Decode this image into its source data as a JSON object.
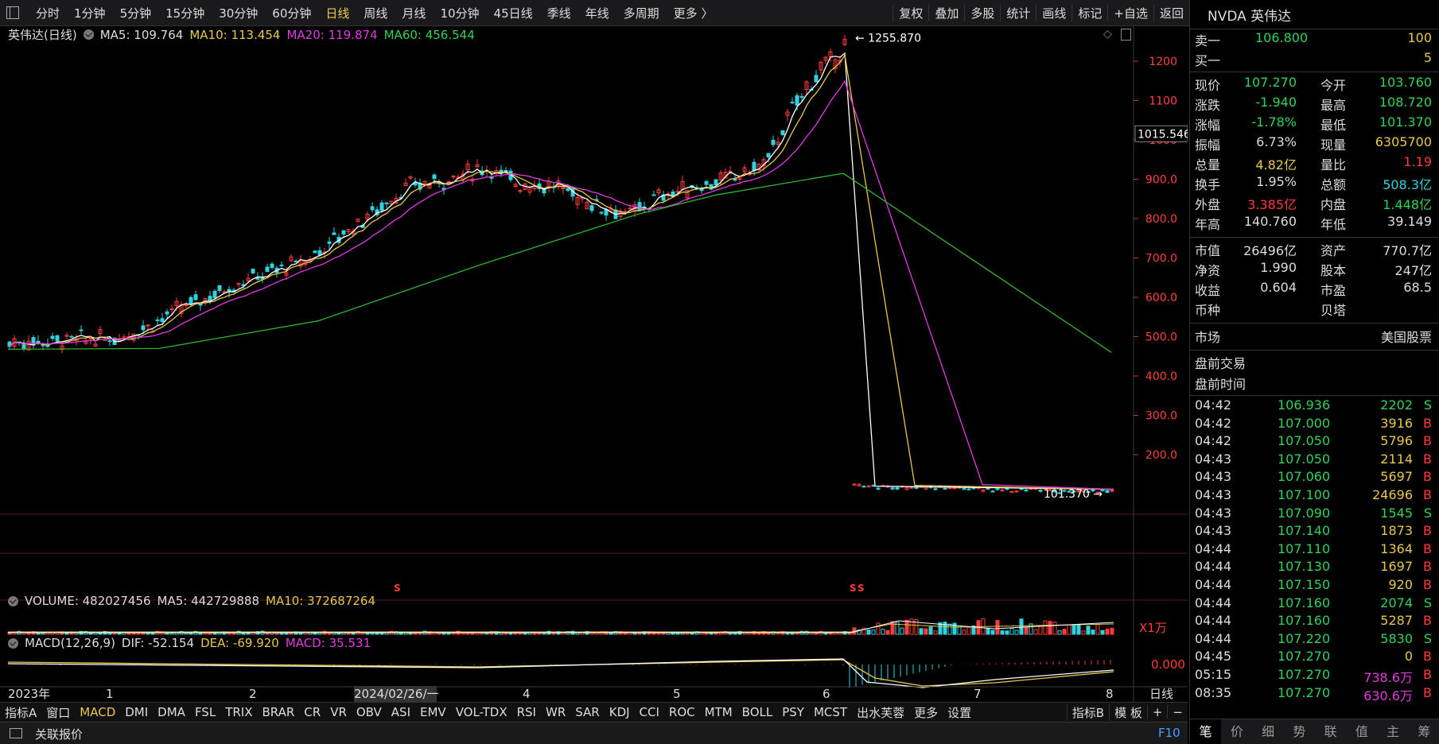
{
  "toolbar": {
    "periods": [
      "分时",
      "1分钟",
      "5分钟",
      "15分钟",
      "30分钟",
      "60分钟",
      "日线",
      "周线",
      "月线",
      "10分钟",
      "45日线",
      "季线",
      "年线",
      "多周期",
      "更多 〉"
    ],
    "active_period": "日线",
    "right_items": [
      "复权",
      "叠加",
      "多股",
      "统计",
      "画线",
      "标记",
      "+自选",
      "返回"
    ]
  },
  "chart": {
    "legend": {
      "title": "英伟达(日线)",
      "ma5": "MA5: 109.764",
      "ma10": "MA10: 113.454",
      "ma20": "MA20: 119.874",
      "ma60": "MA60: 456.544"
    },
    "y_ticks": [
      "1200",
      "1100",
      "1000",
      "900.0",
      "800.0",
      "700.0",
      "600.0",
      "500.0",
      "400.0",
      "300.0",
      "200.0"
    ],
    "current_marker": "1015.546",
    "high_label": "1255.870",
    "low_label": "101.370",
    "volume_legend": {
      "volume": "VOLUME: 482027456",
      "ma5": "MA5: 442729888",
      "ma10": "MA10: 372687264",
      "unit": "X1万"
    },
    "macd_legend": {
      "name": "MACD(12,26,9)",
      "dif": "DIF: -52.154",
      "dea": "DEA: -69.920",
      "macd": "MACD: 35.531",
      "zero": "0.000"
    },
    "x_labels": [
      "2023年",
      "1",
      "2",
      "2024/02/26/一",
      "4",
      "5",
      "6",
      "7",
      "8"
    ],
    "period_label": "日线",
    "signal_mark": "S"
  },
  "chart_data": {
    "type": "candlestick",
    "title": "英伟达(日线)",
    "ylim": [
      100,
      1260
    ],
    "high": 1255.87,
    "low": 101.37,
    "ma_labels": [
      "MA5",
      "MA10",
      "MA20",
      "MA60"
    ],
    "ma_values": [
      109.764,
      113.454,
      119.874,
      456.544
    ],
    "ma_colors": [
      "#ffffff",
      "#e8c84a",
      "#e23be2",
      "#2fb52f"
    ]
  },
  "indicator_tabs": [
    "指标A",
    "窗口",
    "MACD",
    "DMI",
    "DMA",
    "FSL",
    "TRIX",
    "BRAR",
    "CR",
    "VR",
    "OBV",
    "ASI",
    "EMV",
    "VOL-TDX",
    "RSI",
    "WR",
    "SAR",
    "KDJ",
    "CCI",
    "ROC",
    "MTM",
    "BOLL",
    "PSY",
    "MCST",
    "出水芙蓉",
    "更多",
    "设置"
  ],
  "indicator_active": "MACD",
  "indicator_right": [
    "指标B",
    "模 板",
    "+",
    "−"
  ],
  "status": {
    "left": "关联报价",
    "right": "F10"
  },
  "panel": {
    "title": "NVDA 英伟达",
    "ask": {
      "label": "卖一",
      "price": "106.800",
      "vol": "100"
    },
    "bid": {
      "label": "买一",
      "price": "",
      "vol": "5"
    },
    "stats": [
      [
        "现价",
        "107.270",
        "今开",
        "103.760"
      ],
      [
        "涨跌",
        "-1.940",
        "最高",
        "108.720"
      ],
      [
        "涨幅",
        "-1.78%",
        "最低",
        "101.370"
      ],
      [
        "振幅",
        "6.73%",
        "现量",
        "6305700"
      ],
      [
        "总量",
        "4.82亿",
        "量比",
        "1.19"
      ],
      [
        "换手",
        "1.95%",
        "总额",
        "508.3亿"
      ],
      [
        "外盘",
        "3.385亿",
        "内盘",
        "1.448亿"
      ],
      [
        "年高",
        "140.760",
        "年低",
        "39.149"
      ]
    ],
    "fundamentals": [
      [
        "市值",
        "26496亿",
        "资产",
        "770.7亿"
      ],
      [
        "净资",
        "1.990",
        "股本",
        "247亿"
      ],
      [
        "收益",
        "0.604",
        "市盈",
        "68.5"
      ],
      [
        "币种",
        "",
        "贝塔",
        ""
      ]
    ],
    "market_label": "市场",
    "market_value": "美国股票",
    "premarket": "盘前交易",
    "premarket_time": "盘前时间",
    "ticks": [
      [
        "04:42",
        "106.936",
        "2202",
        "S"
      ],
      [
        "04:42",
        "107.000",
        "3916",
        "B"
      ],
      [
        "04:42",
        "107.050",
        "5796",
        "B"
      ],
      [
        "04:43",
        "107.050",
        "2114",
        "B"
      ],
      [
        "04:43",
        "107.060",
        "5697",
        "B"
      ],
      [
        "04:43",
        "107.100",
        "24696",
        "B"
      ],
      [
        "04:43",
        "107.090",
        "1545",
        "S"
      ],
      [
        "04:43",
        "107.140",
        "1873",
        "B"
      ],
      [
        "04:44",
        "107.110",
        "1364",
        "B"
      ],
      [
        "04:44",
        "107.130",
        "1697",
        "B"
      ],
      [
        "04:44",
        "107.150",
        "920",
        "B"
      ],
      [
        "04:44",
        "107.160",
        "2074",
        "S"
      ],
      [
        "04:44",
        "107.160",
        "5287",
        "B"
      ],
      [
        "04:44",
        "107.220",
        "5830",
        "S"
      ],
      [
        "04:45",
        "107.270",
        "0",
        "B"
      ],
      [
        "05:15",
        "107.270",
        "738.6万",
        "B"
      ],
      [
        "08:35",
        "107.270",
        "630.6万",
        "B"
      ]
    ],
    "tabs": [
      "笔",
      "价",
      "细",
      "势",
      "联",
      "值",
      "主",
      "筹"
    ]
  }
}
